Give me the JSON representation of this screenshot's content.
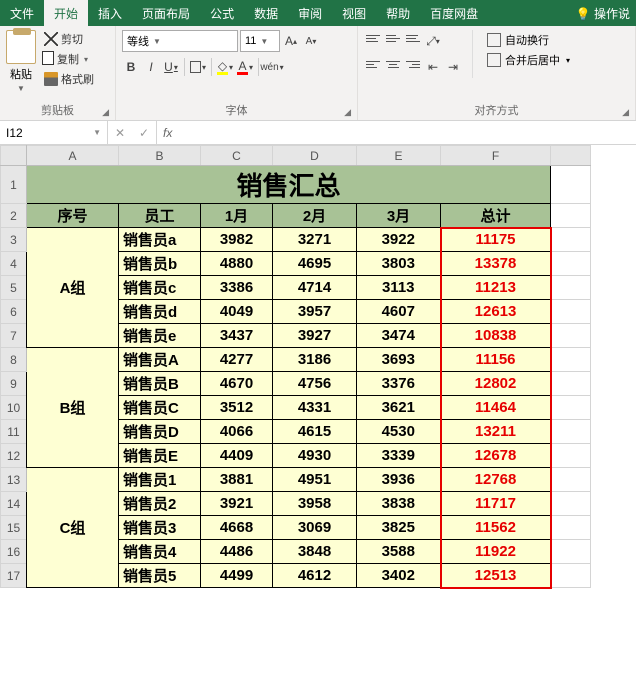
{
  "tabs": [
    "文件",
    "开始",
    "插入",
    "页面布局",
    "公式",
    "数据",
    "审阅",
    "视图",
    "帮助",
    "百度网盘"
  ],
  "active_tab": 1,
  "tell_me": "操作说",
  "clipboard": {
    "paste": "粘贴",
    "cut": "剪切",
    "copy": "复制",
    "brush": "格式刷",
    "label": "剪贴板"
  },
  "font": {
    "name": "等线",
    "size": "11",
    "label": "字体",
    "bold": "B",
    "italic": "I",
    "underline": "U",
    "inc": "A",
    "dec": "A"
  },
  "align": {
    "label": "对齐方式",
    "wrap": "自动换行",
    "merge": "合并后居中"
  },
  "namebox": "I12",
  "fx": "fx",
  "columns": [
    "A",
    "B",
    "C",
    "D",
    "E",
    "F"
  ],
  "sheet_title": "销售汇总",
  "headers": [
    "序号",
    "员工",
    "1月",
    "2月",
    "3月",
    "总计"
  ],
  "groups": [
    {
      "name": "A组",
      "rows": [
        {
          "emp": "销售员a",
          "m": [
            3982,
            3271,
            3922
          ],
          "t": 11175
        },
        {
          "emp": "销售员b",
          "m": [
            4880,
            4695,
            3803
          ],
          "t": 13378
        },
        {
          "emp": "销售员c",
          "m": [
            3386,
            4714,
            3113
          ],
          "t": 11213
        },
        {
          "emp": "销售员d",
          "m": [
            4049,
            3957,
            4607
          ],
          "t": 12613
        },
        {
          "emp": "销售员e",
          "m": [
            3437,
            3927,
            3474
          ],
          "t": 10838
        }
      ]
    },
    {
      "name": "B组",
      "rows": [
        {
          "emp": "销售员A",
          "m": [
            4277,
            3186,
            3693
          ],
          "t": 11156
        },
        {
          "emp": "销售员B",
          "m": [
            4670,
            4756,
            3376
          ],
          "t": 12802
        },
        {
          "emp": "销售员C",
          "m": [
            3512,
            4331,
            3621
          ],
          "t": 11464
        },
        {
          "emp": "销售员D",
          "m": [
            4066,
            4615,
            4530
          ],
          "t": 13211
        },
        {
          "emp": "销售员E",
          "m": [
            4409,
            4930,
            3339
          ],
          "t": 12678
        }
      ]
    },
    {
      "name": "C组",
      "rows": [
        {
          "emp": "销售员1",
          "m": [
            3881,
            4951,
            3936
          ],
          "t": 12768
        },
        {
          "emp": "销售员2",
          "m": [
            3921,
            3958,
            3838
          ],
          "t": 11717
        },
        {
          "emp": "销售员3",
          "m": [
            4668,
            3069,
            3825
          ],
          "t": 11562
        },
        {
          "emp": "销售员4",
          "m": [
            4486,
            3848,
            3588
          ],
          "t": 11922
        },
        {
          "emp": "销售员5",
          "m": [
            4499,
            4612,
            3402
          ],
          "t": 12513
        }
      ]
    }
  ]
}
